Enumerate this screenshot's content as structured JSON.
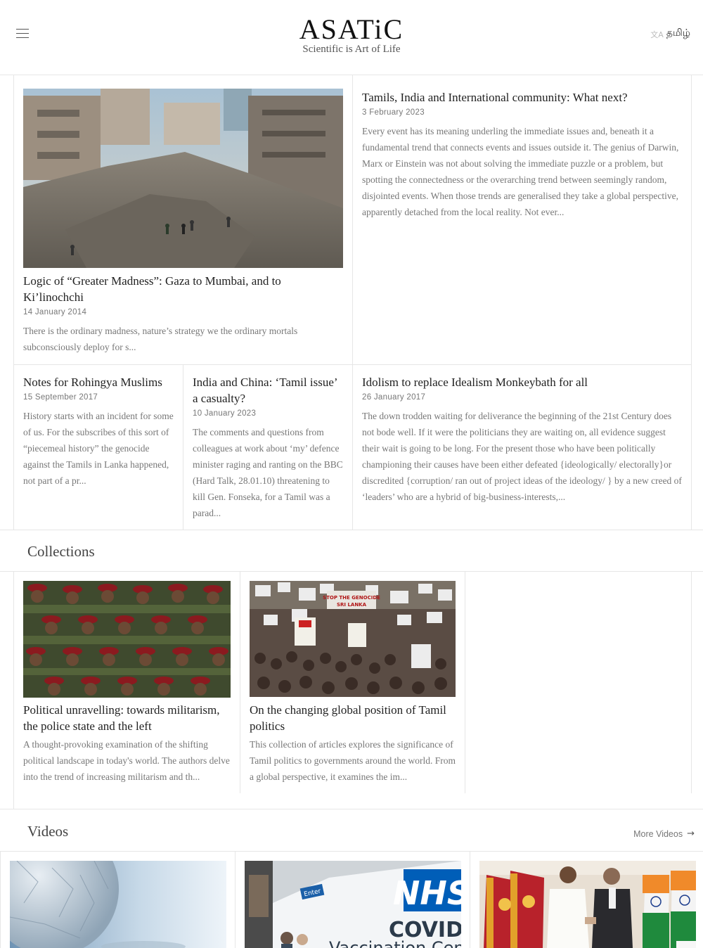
{
  "header": {
    "logo": "ASATiC",
    "tagline": "Scientific is Art of Life",
    "language_label": "தமிழ்"
  },
  "articles": [
    {
      "title": "Logic of “Greater Madness”: Gaza to Mumbai, and to Ki’linochchi",
      "date": "14 January 2014",
      "excerpt": "There is the ordinary madness, nature’s strategy we the ordinary mortals subconsciously deploy for s..."
    },
    {
      "title": "Tamils, India and International community: What next?",
      "date": "3 February 2023",
      "excerpt": "Every event has its meaning underling the immediate issues and, beneath it a fundamental trend that connects events and issues outside it. The genius of Darwin, Marx or Einstein was not about solving the immediate puzzle or a problem, but spotting the connectedness or the overarching trend between seemingly random, disjointed events. When those trends are generalised they take a global perspective, apparently detached from the local reality. Not ever..."
    },
    {
      "title": "Notes for Rohingya Muslims",
      "date": "15 September 2017",
      "excerpt": "History starts with an incident for some of us. For the subscribes of this sort of “piecemeal history” the genocide against the Tamils in Lanka happened, not part of a pr..."
    },
    {
      "title": "India and China: ‘Tamil issue’ a casualty?",
      "date": "10 January 2023",
      "excerpt": "The comments and questions from colleagues at work about ‘my’ defence minister raging and ranting on the BBC (Hard Talk, 28.01.10) threatening to kill Gen. Fonseka, for a Tamil was a parad..."
    },
    {
      "title": "Idolism to replace Idealism Monkeybath for all",
      "date": "26 January 2017",
      "excerpt": "The down trodden waiting for deliverance the beginning of the 21st Century does not bode well. If it were the politicians they are waiting on, all evidence suggest their wait is going to be long. For the present those who have been politically championing their causes have been either defeated {ideologically/ electorally}or discredited {corruption/ ran out of project ideas of the ideology/ } by a new creed of ‘leaders’ who are a hybrid of big-business-interests,..."
    }
  ],
  "collections": {
    "heading": "Collections",
    "items": [
      {
        "title": "Political unravelling: towards militarism, the police state and the left",
        "excerpt": "A thought-provoking examination of the shifting political landscape in today's world. The authors delve into the trend of increasing militarism and th..."
      },
      {
        "title": "On the changing global position of Tamil politics",
        "excerpt": "This collection of articles explores the significance of Tamil politics to governments around the world. From a global perspective, it examines the im..."
      }
    ]
  },
  "videos": {
    "heading": "Videos",
    "more_label": "More Videos",
    "thumb_texts": [
      "Enter",
      "NHS",
      "COVID-",
      "Vaccination Cen"
    ]
  },
  "icons": {
    "menu": "hamburger-icon",
    "translate": "translate-icon",
    "more_arrow": "arrow-right-icon"
  }
}
